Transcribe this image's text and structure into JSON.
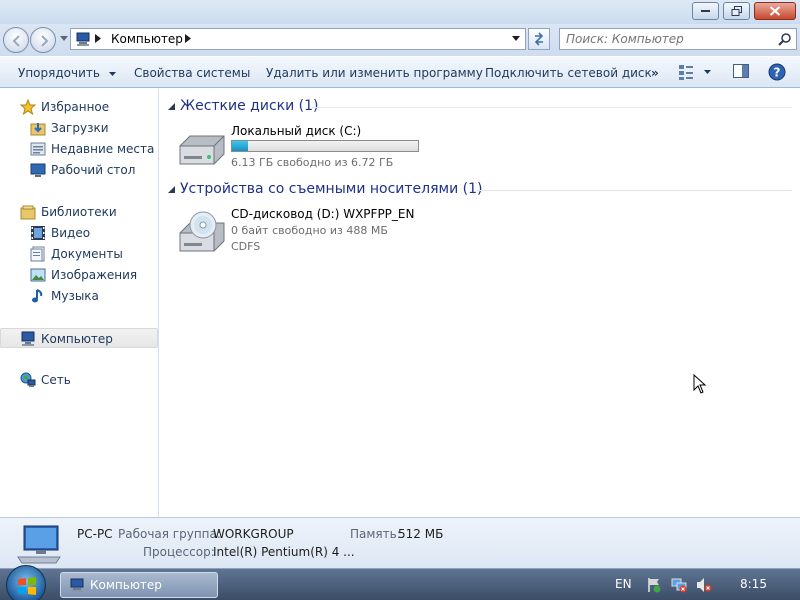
{
  "window": {
    "title": "Компьютер",
    "controls": [
      "minimize-icon",
      "maximize-icon",
      "close-icon"
    ]
  },
  "address": {
    "breadcrumb": "Компьютер",
    "search_placeholder": "Поиск: Компьютер"
  },
  "toolbar": {
    "organize": "Упорядочить",
    "system_properties": "Свойства системы",
    "uninstall": "Удалить или изменить программу",
    "map_drive": "Подключить сетевой диск",
    "more": "»"
  },
  "nav": {
    "favorites": "Избранное",
    "downloads": "Загрузки",
    "recent": "Недавние места",
    "desktop": "Рабочий стол",
    "libraries": "Библиотеки",
    "video": "Видео",
    "documents": "Документы",
    "images": "Изображения",
    "music": "Музыка",
    "computer": "Компьютер",
    "network": "Сеть"
  },
  "groups": {
    "hdd": {
      "title": "Жесткие диски (1)",
      "drive_name": "Локальный диск (C:)",
      "free_text": "6.13 ГБ свободно из 6.72 ГБ",
      "used_fraction": 0.088
    },
    "removable": {
      "title": "Устройства со съемными носителями (1)",
      "drive_name": "CD-дисковод (D:) WXPFPP_EN",
      "free_text": "0 байт свободно из 488 МБ",
      "fs": "CDFS"
    }
  },
  "details": {
    "name": "PC-PC",
    "workgroup_label": "Рабочая группа:",
    "workgroup": "WORKGROUP",
    "memory_label": "Память:",
    "memory": "512 МБ",
    "cpu_label": "Процессор:",
    "cpu": "Intel(R) Pentium(R) 4 ..."
  },
  "taskbar": {
    "window_button": "Компьютер",
    "language": "EN",
    "time": "8:15"
  },
  "colors": {
    "accent": "#1e395b",
    "group_heading": "#1e3287",
    "bar_fill": "#26a8dc"
  }
}
